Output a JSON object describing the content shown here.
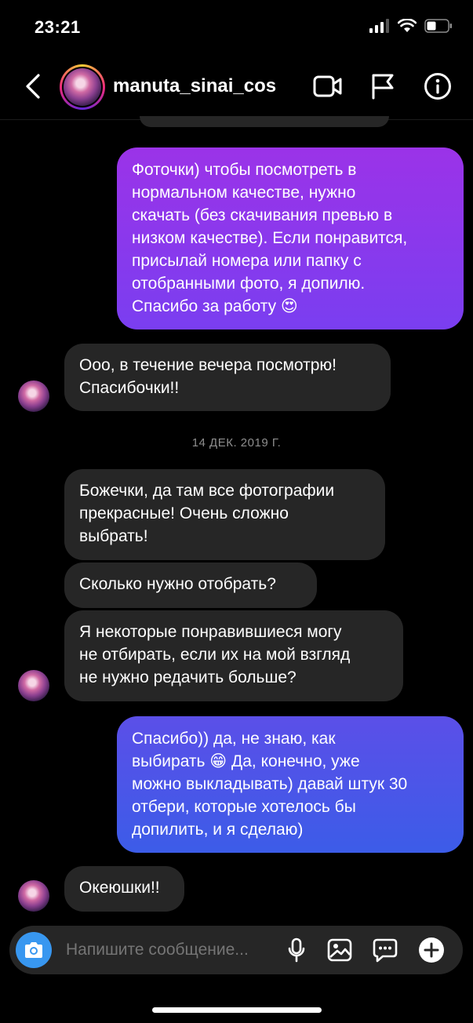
{
  "status": {
    "time": "23:21"
  },
  "header": {
    "username": "manuta_sinai_cos"
  },
  "messages": {
    "out1": [
      "Фоточки) чтобы посмотреть в",
      "нормальном качестве, нужно",
      "скачать (без скачивания превью в",
      "низком качестве). Если понравится,",
      "присылай номера или папку с",
      "отобранными фото, я допилю.",
      "Спасибо за работу 😍"
    ],
    "in1": [
      "Ооо, в течение вечера посмотрю!",
      "Спасибочки!!"
    ],
    "date": "14 ДЕК. 2019 Г.",
    "in2": [
      "Божечки, да там все фотографии",
      "прекрасные! Очень сложно",
      "выбрать!"
    ],
    "in3": [
      "Сколько нужно отобрать?"
    ],
    "in4": [
      "Я некоторые понравившиеся могу",
      "не отбирать, если их на мой взгляд",
      "не нужно редачить больше?"
    ],
    "out2": [
      "Спасибо)) да, не знаю, как",
      "выбирать 😁 Да, конечно, уже",
      "можно выкладывать) давай штук 30",
      "отбери, которые хотелось бы",
      "допилить, и я сделаю)"
    ],
    "in5": [
      "Океюшки!!"
    ]
  },
  "composer": {
    "placeholder": "Напишите сообщение..."
  },
  "colors": {
    "out1_top": "#9b33e8",
    "out1_bottom": "#7a3ef0",
    "out2_top": "#5b4fe8",
    "out2_bottom": "#3c5ce8",
    "incoming": "#262626",
    "accent": "#3897f0"
  }
}
